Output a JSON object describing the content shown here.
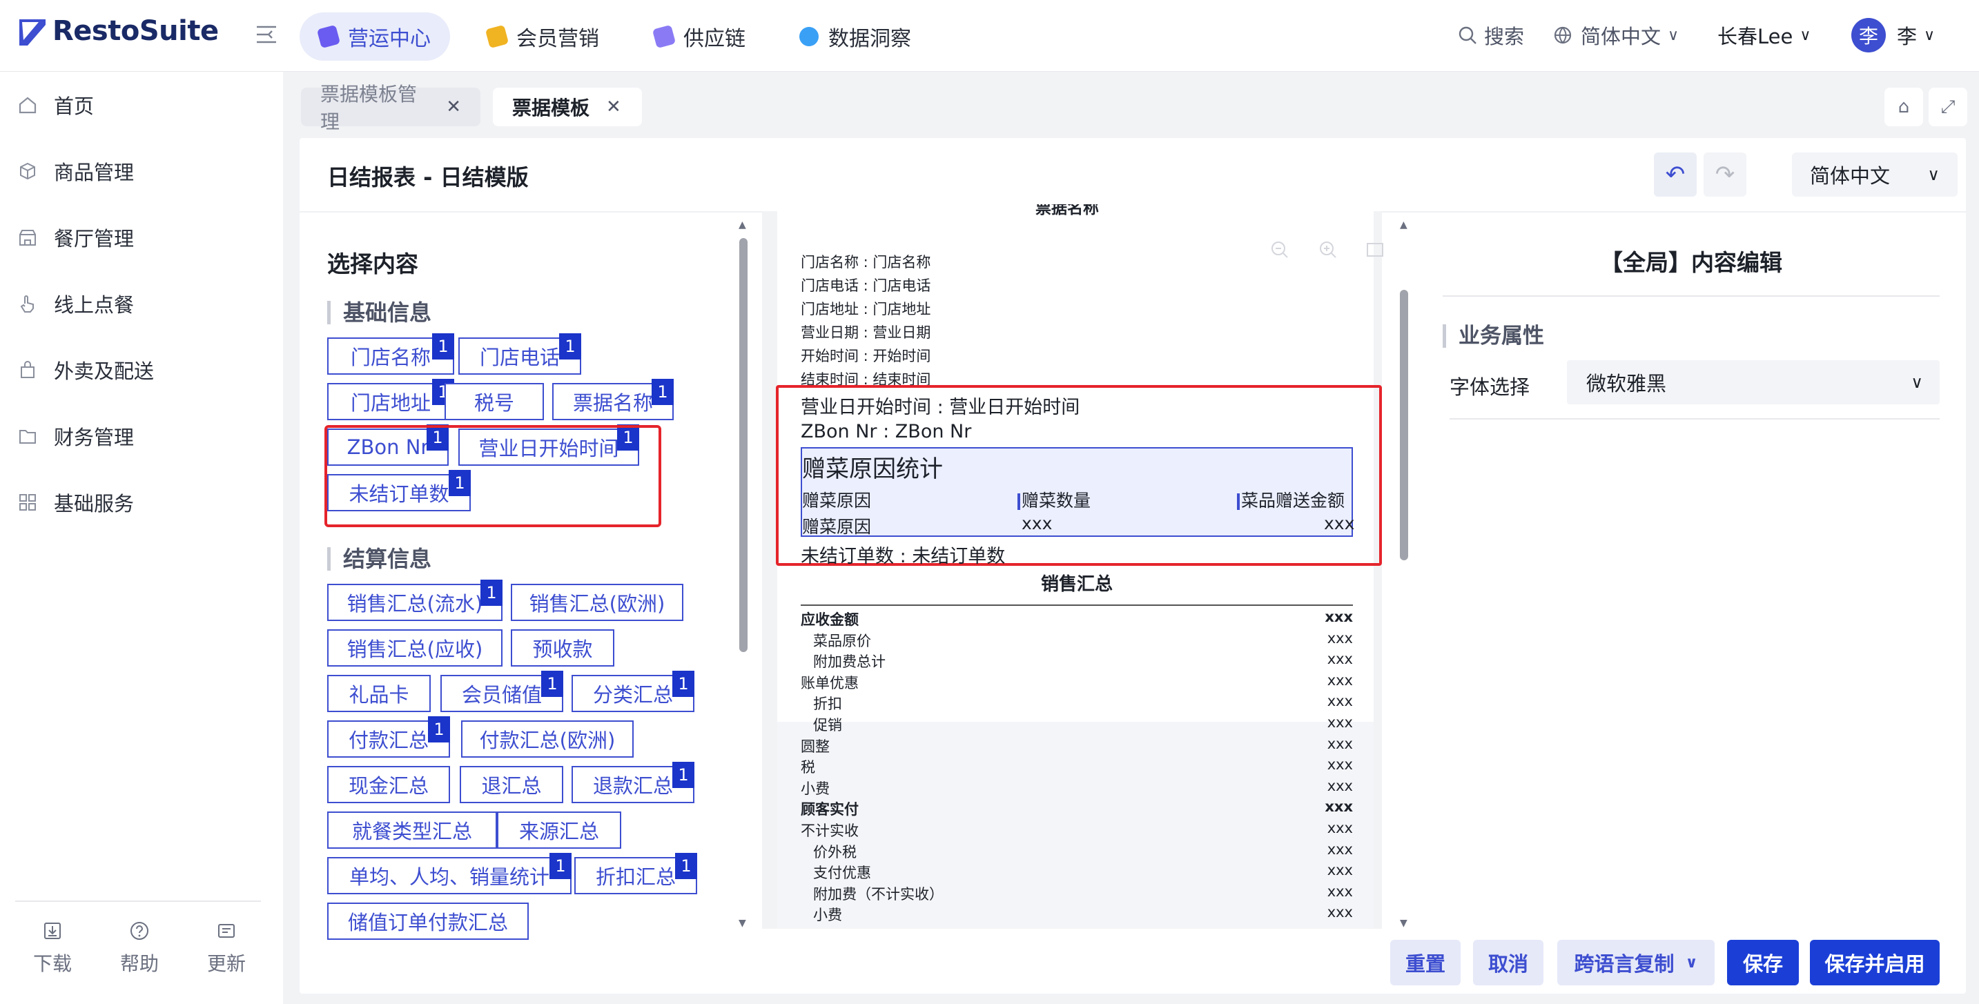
{
  "app": {
    "name": "RestoSuite"
  },
  "topnav": [
    {
      "label": "营运中心",
      "color": "#6a5cf0"
    },
    {
      "label": "会员营销",
      "color": "#f0b322"
    },
    {
      "label": "供应链",
      "color": "#8a7bf5"
    },
    {
      "label": "数据洞察",
      "color": "#3aa0f5"
    }
  ],
  "header": {
    "search": "搜索",
    "language": "简体中文",
    "store": "长春Lee",
    "avatar_initial": "李",
    "user": "李"
  },
  "sidebar": {
    "items": [
      {
        "label": "首页",
        "icon": "home-icon"
      },
      {
        "label": "商品管理",
        "icon": "cube-icon"
      },
      {
        "label": "餐厅管理",
        "icon": "store-icon"
      },
      {
        "label": "线上点餐",
        "icon": "hand-tap-icon"
      },
      {
        "label": "外卖及配送",
        "icon": "bag-icon"
      },
      {
        "label": "财务管理",
        "icon": "folder-icon"
      },
      {
        "label": "基础服务",
        "icon": "grid-icon"
      }
    ],
    "footer": [
      {
        "label": "下载"
      },
      {
        "label": "帮助"
      },
      {
        "label": "更新"
      }
    ]
  },
  "tabs": [
    {
      "label": "票据模板管理"
    },
    {
      "label": "票据模板"
    }
  ],
  "page": {
    "title": "日结报表 - 日结模版",
    "language": "简体中文"
  },
  "left_panel": {
    "title": "选择内容",
    "sections": [
      {
        "title": "基础信息",
        "chips": [
          {
            "label": "门店名称",
            "badge": "1"
          },
          {
            "label": "门店电话",
            "badge": "1"
          },
          {
            "label": "门店地址",
            "badge": "1"
          },
          {
            "label": "税号",
            "badge": ""
          },
          {
            "label": "票据名称",
            "badge": "1"
          },
          {
            "label": "ZBon Nr",
            "badge": "1"
          },
          {
            "label": "营业日开始时间",
            "badge": "1"
          },
          {
            "label": "未结订单数",
            "badge": "1"
          }
        ]
      },
      {
        "title": "结算信息",
        "chips": [
          {
            "label": "销售汇总(流水)",
            "badge": "1"
          },
          {
            "label": "销售汇总(欧洲)",
            "badge": ""
          },
          {
            "label": "销售汇总(应收)",
            "badge": ""
          },
          {
            "label": "预收款",
            "badge": ""
          },
          {
            "label": "礼品卡",
            "badge": ""
          },
          {
            "label": "会员储值",
            "badge": "1"
          },
          {
            "label": "分类汇总",
            "badge": "1"
          },
          {
            "label": "付款汇总",
            "badge": "1"
          },
          {
            "label": "付款汇总(欧洲)",
            "badge": ""
          },
          {
            "label": "现金汇总",
            "badge": ""
          },
          {
            "label": "退汇总",
            "badge": ""
          },
          {
            "label": "退款汇总",
            "badge": "1"
          },
          {
            "label": "就餐类型汇总",
            "badge": ""
          },
          {
            "label": "来源汇总",
            "badge": ""
          },
          {
            "label": "单均、人均、销量统计",
            "badge": "1"
          },
          {
            "label": "折扣汇总",
            "badge": "1"
          },
          {
            "label": "储值订单付款汇总",
            "badge": ""
          }
        ]
      }
    ]
  },
  "preview": {
    "header_cut": "票据名称",
    "info_lines": [
      "门店名称 : 门店名称",
      "门店电话 : 门店电话",
      "门店地址 : 门店地址",
      "营业日期 : 营业日期",
      "开始时间 : 开始时间",
      "结束时间 : 结束时间"
    ],
    "highlight_lines": [
      "营业日开始时间 : 营业日开始时间",
      "ZBon Nr : ZBon Nr"
    ],
    "gift_title": "赠菜原因统计",
    "gift_headers": [
      "赠菜原因",
      "赠菜数量",
      "菜品赠送金额"
    ],
    "gift_row": [
      "赠菜原因",
      "xxx",
      "xxx"
    ],
    "unsettled_line": "未结订单数 : 未结订单数",
    "sales_title": "销售汇总",
    "sales_rows": [
      {
        "label": "应收金额",
        "value": "xxx",
        "bold": true,
        "indent": false
      },
      {
        "label": "菜品原价",
        "value": "xxx",
        "bold": false,
        "indent": true
      },
      {
        "label": "附加费总计",
        "value": "xxx",
        "bold": false,
        "indent": true
      },
      {
        "label": "账单优惠",
        "value": "xxx",
        "bold": false,
        "indent": false
      },
      {
        "label": "折扣",
        "value": "xxx",
        "bold": false,
        "indent": true
      },
      {
        "label": "促销",
        "value": "xxx",
        "bold": false,
        "indent": true
      },
      {
        "label": "圆整",
        "value": "xxx",
        "bold": false,
        "indent": false
      },
      {
        "label": "税",
        "value": "xxx",
        "bold": false,
        "indent": false
      },
      {
        "label": "小费",
        "value": "xxx",
        "bold": false,
        "indent": false
      },
      {
        "label": "顾客实付",
        "value": "xxx",
        "bold": true,
        "indent": false
      },
      {
        "label": "不计实收",
        "value": "xxx",
        "bold": false,
        "indent": false
      },
      {
        "label": "价外税",
        "value": "xxx",
        "bold": false,
        "indent": true
      },
      {
        "label": "支付优惠",
        "value": "xxx",
        "bold": false,
        "indent": true
      },
      {
        "label": "附加费（不计实收）",
        "value": "xxx",
        "bold": false,
        "indent": true
      },
      {
        "label": "小费",
        "value": "xxx",
        "bold": false,
        "indent": true
      }
    ]
  },
  "right_panel": {
    "title": "【全局】内容编辑",
    "section": "业务属性",
    "font_label": "字体选择",
    "font_value": "微软雅黑"
  },
  "footer_buttons": {
    "reset": "重置",
    "cancel": "取消",
    "copy": "跨语言复制",
    "save": "保存",
    "save_enable": "保存并启用"
  },
  "colors": {
    "primary": "#1b3fd6",
    "accent": "#3d4ed0",
    "highlight": "#e5242b"
  }
}
